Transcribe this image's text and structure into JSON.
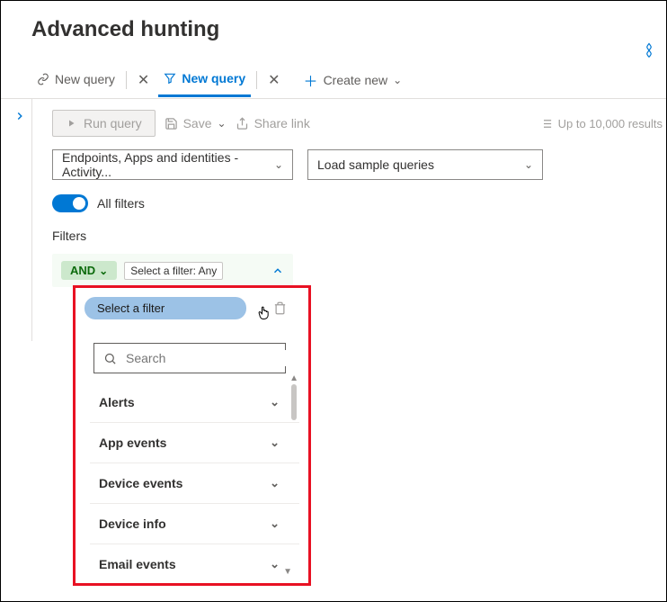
{
  "header": {
    "title": "Advanced hunting"
  },
  "tabs": {
    "items": [
      {
        "label": "New query"
      },
      {
        "label": "New query"
      }
    ],
    "create_label": "Create new"
  },
  "toolbar": {
    "run_label": "Run query",
    "save_label": "Save",
    "share_label": "Share link",
    "results_hint": "Up to 10,000 results"
  },
  "selectors": {
    "dataset_label": "Endpoints, Apps and identities - Activity...",
    "samples_label": "Load sample queries"
  },
  "filters": {
    "toggle_label": "All filters",
    "section_label": "Filters",
    "and_label": "AND",
    "tooltip": "Select a filter: Any",
    "select_filter_label": "Select a filter",
    "search_placeholder": "Search",
    "categories": [
      "Alerts",
      "App events",
      "Device events",
      "Device info",
      "Email events"
    ]
  }
}
